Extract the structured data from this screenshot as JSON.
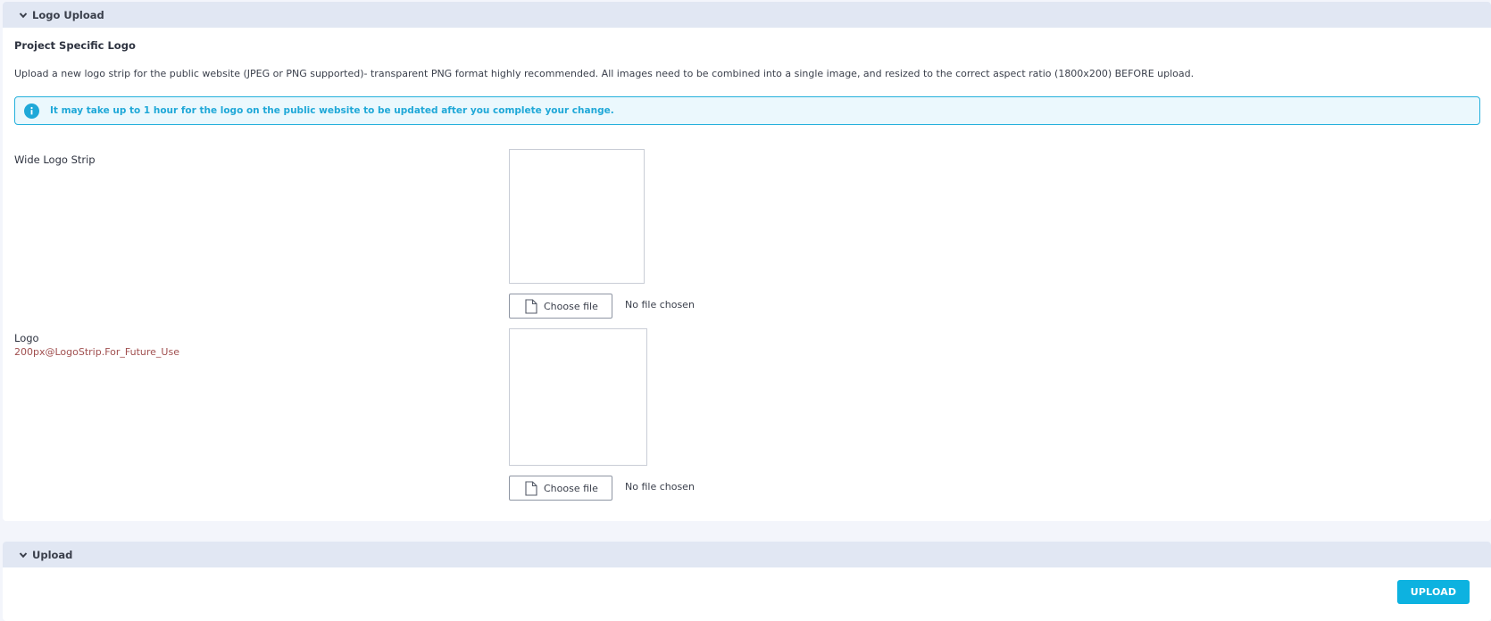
{
  "logo_panel": {
    "header": "Logo Upload",
    "section_title": "Project Specific Logo",
    "description": "Upload a new logo strip for the public website (JPEG or PNG supported)- transparent PNG format highly recommended. All images need to be combined into a single image, and resized to the correct aspect ratio (1800x200) BEFORE upload.",
    "info": "It may take up to 1 hour for the logo on the public website to be updated after you complete your change.",
    "fields": [
      {
        "label": "Wide Logo Strip",
        "sublabel": "",
        "button": "Choose file",
        "status": "No file chosen"
      },
      {
        "label": "Logo",
        "sublabel": "200px@LogoStrip.For_Future_Use",
        "button": "Choose file",
        "status": "No file chosen"
      }
    ]
  },
  "upload_panel": {
    "header": "Upload",
    "button": "UPLOAD"
  },
  "colors": {
    "header_bg": "#e1e7f3",
    "info_accent": "#1fa8d8",
    "primary_button": "#0db2e0",
    "sublabel": "#a04f4f"
  },
  "icons": {
    "collapse": "chevron-down-icon",
    "info": "info-icon",
    "file": "document-icon"
  }
}
